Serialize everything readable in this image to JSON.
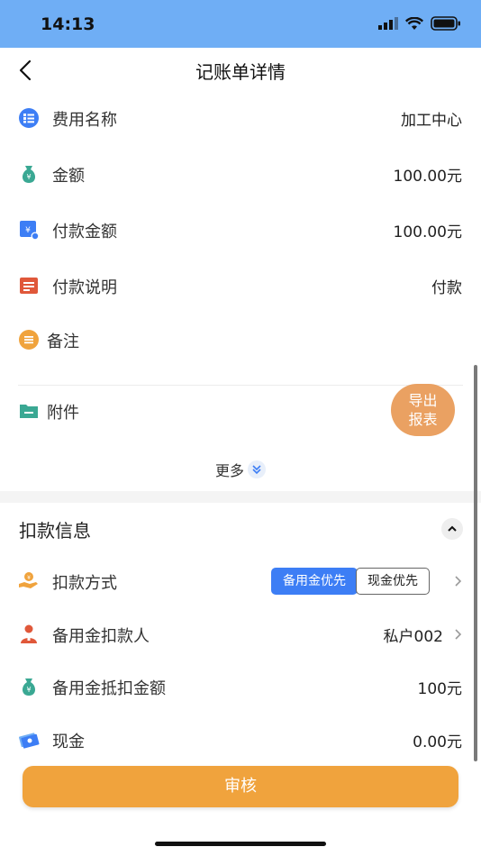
{
  "status": {
    "time": "14:13"
  },
  "nav": {
    "title": "记账单详情"
  },
  "details": [
    {
      "label": "费用名称",
      "value": "加工中心",
      "icon": "list-icon"
    },
    {
      "label": "金额",
      "value": "100.00元",
      "icon": "money-bag-icon"
    },
    {
      "label": "付款金额",
      "value": "100.00元",
      "icon": "payment-icon"
    },
    {
      "label": "付款说明",
      "value": "付款",
      "icon": "note-icon"
    },
    {
      "label": "备注",
      "value": "",
      "icon": "menu-circle-icon"
    },
    {
      "label": "附件",
      "value": "",
      "icon": "folder-icon"
    }
  ],
  "more_label": "更多",
  "export": {
    "line1": "导出",
    "line2": "报表"
  },
  "deduction": {
    "title": "扣款信息",
    "method_label": "扣款方式",
    "method_options": [
      "备用金优先",
      "现金优先"
    ],
    "payer_label": "备用金扣款人",
    "payer_value": "私户002",
    "offset_label": "备用金抵扣金额",
    "offset_value": "100元",
    "cash_label": "现金",
    "cash_value": "0.00元"
  },
  "audit_button": "审核",
  "colors": {
    "status_bar": "#6faef5",
    "primary": "#3d7ef5",
    "audit": "#f0a33d",
    "export": "#e99c5a"
  }
}
